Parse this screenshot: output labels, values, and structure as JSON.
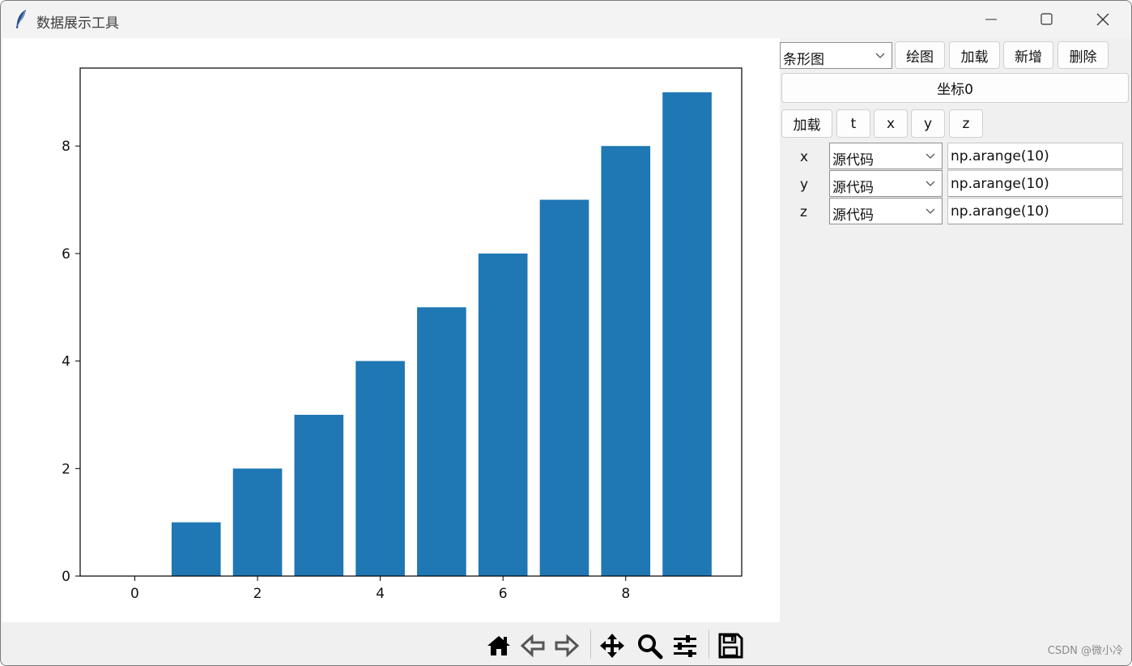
{
  "window": {
    "title": "数据展示工具",
    "icon": "feather-icon",
    "controls": [
      "minimize-icon",
      "maximize-icon",
      "close-icon"
    ]
  },
  "side_panel": {
    "chart_type_select": "条形图",
    "buttons": {
      "draw": "绘图",
      "load": "加载",
      "add": "新增",
      "delete": "删除"
    },
    "axes_tab": "坐标0",
    "axis_buttons": {
      "load": "加载",
      "t": "t",
      "x": "x",
      "y": "y",
      "z": "z"
    },
    "rows": [
      {
        "label": "x",
        "source": "源代码",
        "expr": "np.arange(10)"
      },
      {
        "label": "y",
        "source": "源代码",
        "expr": "np.arange(10)"
      },
      {
        "label": "z",
        "source": "源代码",
        "expr": "np.arange(10)"
      }
    ]
  },
  "toolbar": {
    "icons": [
      "home-icon",
      "back-icon",
      "forward-icon",
      "pan-icon",
      "zoom-icon",
      "configure-subplots-icon",
      "save-icon"
    ]
  },
  "watermark": "CSDN @微小冷",
  "colors": {
    "bar": "#1f77b4",
    "axes": "#000000",
    "background": "#ffffff",
    "panel": "#f0f0f0"
  },
  "chart_data": {
    "type": "bar",
    "x": [
      0,
      1,
      2,
      3,
      4,
      5,
      6,
      7,
      8,
      9
    ],
    "values": [
      0,
      1,
      2,
      3,
      4,
      5,
      6,
      7,
      8,
      9
    ],
    "xticks": [
      0,
      2,
      4,
      6,
      8
    ],
    "yticks": [
      0,
      2,
      4,
      6,
      8
    ],
    "xlim": [
      -0.89,
      9.89
    ],
    "ylim": [
      0,
      9.45
    ],
    "title": "",
    "xlabel": "",
    "ylabel": "",
    "grid": false,
    "legend": "none"
  }
}
